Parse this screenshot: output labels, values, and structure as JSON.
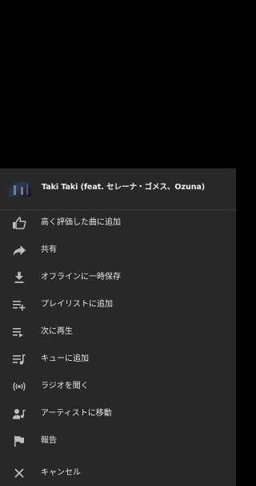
{
  "now_playing": {
    "title": "Taki Taki (feat. セレーナ・ゴメス、Ozuna)"
  },
  "menu": {
    "items": [
      {
        "label": "高く評価した曲に追加",
        "icon": "thumb-up-icon"
      },
      {
        "label": "共有",
        "icon": "share-icon"
      },
      {
        "label": "オフラインに一時保存",
        "icon": "download-icon"
      },
      {
        "label": "プレイリストに追加",
        "icon": "playlist-add-icon"
      },
      {
        "label": "次に再生",
        "icon": "play-next-icon"
      },
      {
        "label": "キューに追加",
        "icon": "add-to-queue-icon"
      },
      {
        "label": "ラジオを聞く",
        "icon": "radio-icon"
      },
      {
        "label": "アーティストに移動",
        "icon": "artist-icon"
      },
      {
        "label": "報告",
        "icon": "flag-icon"
      },
      {
        "label": "キャンセル",
        "icon": "close-icon"
      }
    ]
  },
  "colors": {
    "sheet_background": "#282828",
    "text": "#e6e6e6",
    "icon": "#bdbdbd"
  }
}
